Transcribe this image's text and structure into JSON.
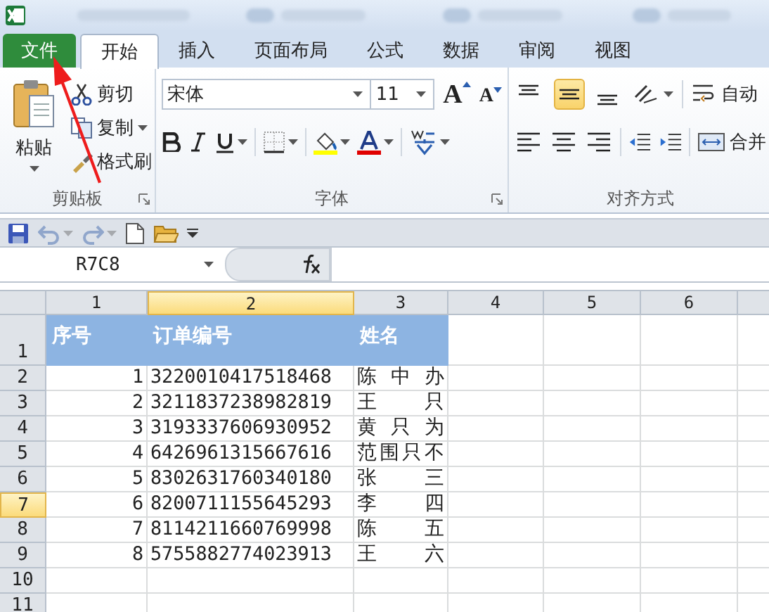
{
  "tabs": [
    {
      "label": "文件",
      "kind": "file",
      "selected": false
    },
    {
      "label": "开始",
      "kind": "tab",
      "selected": true
    },
    {
      "label": "插入",
      "kind": "tab",
      "selected": false
    },
    {
      "label": "页面布局",
      "kind": "tab",
      "selected": false
    },
    {
      "label": "公式",
      "kind": "tab",
      "selected": false
    },
    {
      "label": "数据",
      "kind": "tab",
      "selected": false
    },
    {
      "label": "审阅",
      "kind": "tab",
      "selected": false
    },
    {
      "label": "视图",
      "kind": "tab",
      "selected": false
    }
  ],
  "ribbon": {
    "clipboard": {
      "paste": "粘贴",
      "cut": "剪切",
      "copy": "复制",
      "format_painter": "格式刷",
      "label": "剪贴板"
    },
    "font": {
      "font_name": "宋体",
      "font_size": "11",
      "grow_font": "A",
      "shrink_font": "A",
      "label": "字体"
    },
    "alignment": {
      "vertical_align": [
        {
          "selected": false
        },
        {
          "selected": true
        },
        {
          "selected": false
        }
      ],
      "wrap_text": "自动",
      "merge": "合并",
      "label": "对齐方式"
    }
  },
  "quick_access": {
    "undo_disabled": true,
    "redo_disabled": true
  },
  "formula_bar": {
    "name_box": "R7C8"
  },
  "sheet": {
    "columns": [
      {
        "label": "1",
        "selected": false
      },
      {
        "label": "2",
        "selected": true
      },
      {
        "label": "3",
        "selected": false
      },
      {
        "label": "4",
        "selected": false
      },
      {
        "label": "5",
        "selected": false
      },
      {
        "label": "6",
        "selected": false
      }
    ],
    "rows": [
      {
        "label": "1",
        "selected": false
      },
      {
        "label": "2",
        "selected": false
      },
      {
        "label": "3",
        "selected": false
      },
      {
        "label": "4",
        "selected": false
      },
      {
        "label": "5",
        "selected": false
      },
      {
        "label": "6",
        "selected": false
      },
      {
        "label": "7",
        "selected": true
      },
      {
        "label": "8",
        "selected": false
      },
      {
        "label": "9",
        "selected": false
      },
      {
        "label": "10",
        "selected": false
      },
      {
        "label": "11",
        "selected": false
      }
    ],
    "header_cells": [
      "序号",
      "订单编号",
      "姓名"
    ],
    "data": [
      [
        "1",
        "3220010417518468",
        "陈中办"
      ],
      [
        "2",
        "3211837238982819",
        "王只"
      ],
      [
        "3",
        "3193337606930952",
        "黄只为"
      ],
      [
        "4",
        "6426961315667616",
        "范围只不"
      ],
      [
        "5",
        "8302631760340180",
        "张三"
      ],
      [
        "6",
        "8200711155645293",
        "李四"
      ],
      [
        "7",
        "8114211660769998",
        "陈五"
      ],
      [
        "8",
        "5755882774023913",
        "王六"
      ]
    ]
  }
}
